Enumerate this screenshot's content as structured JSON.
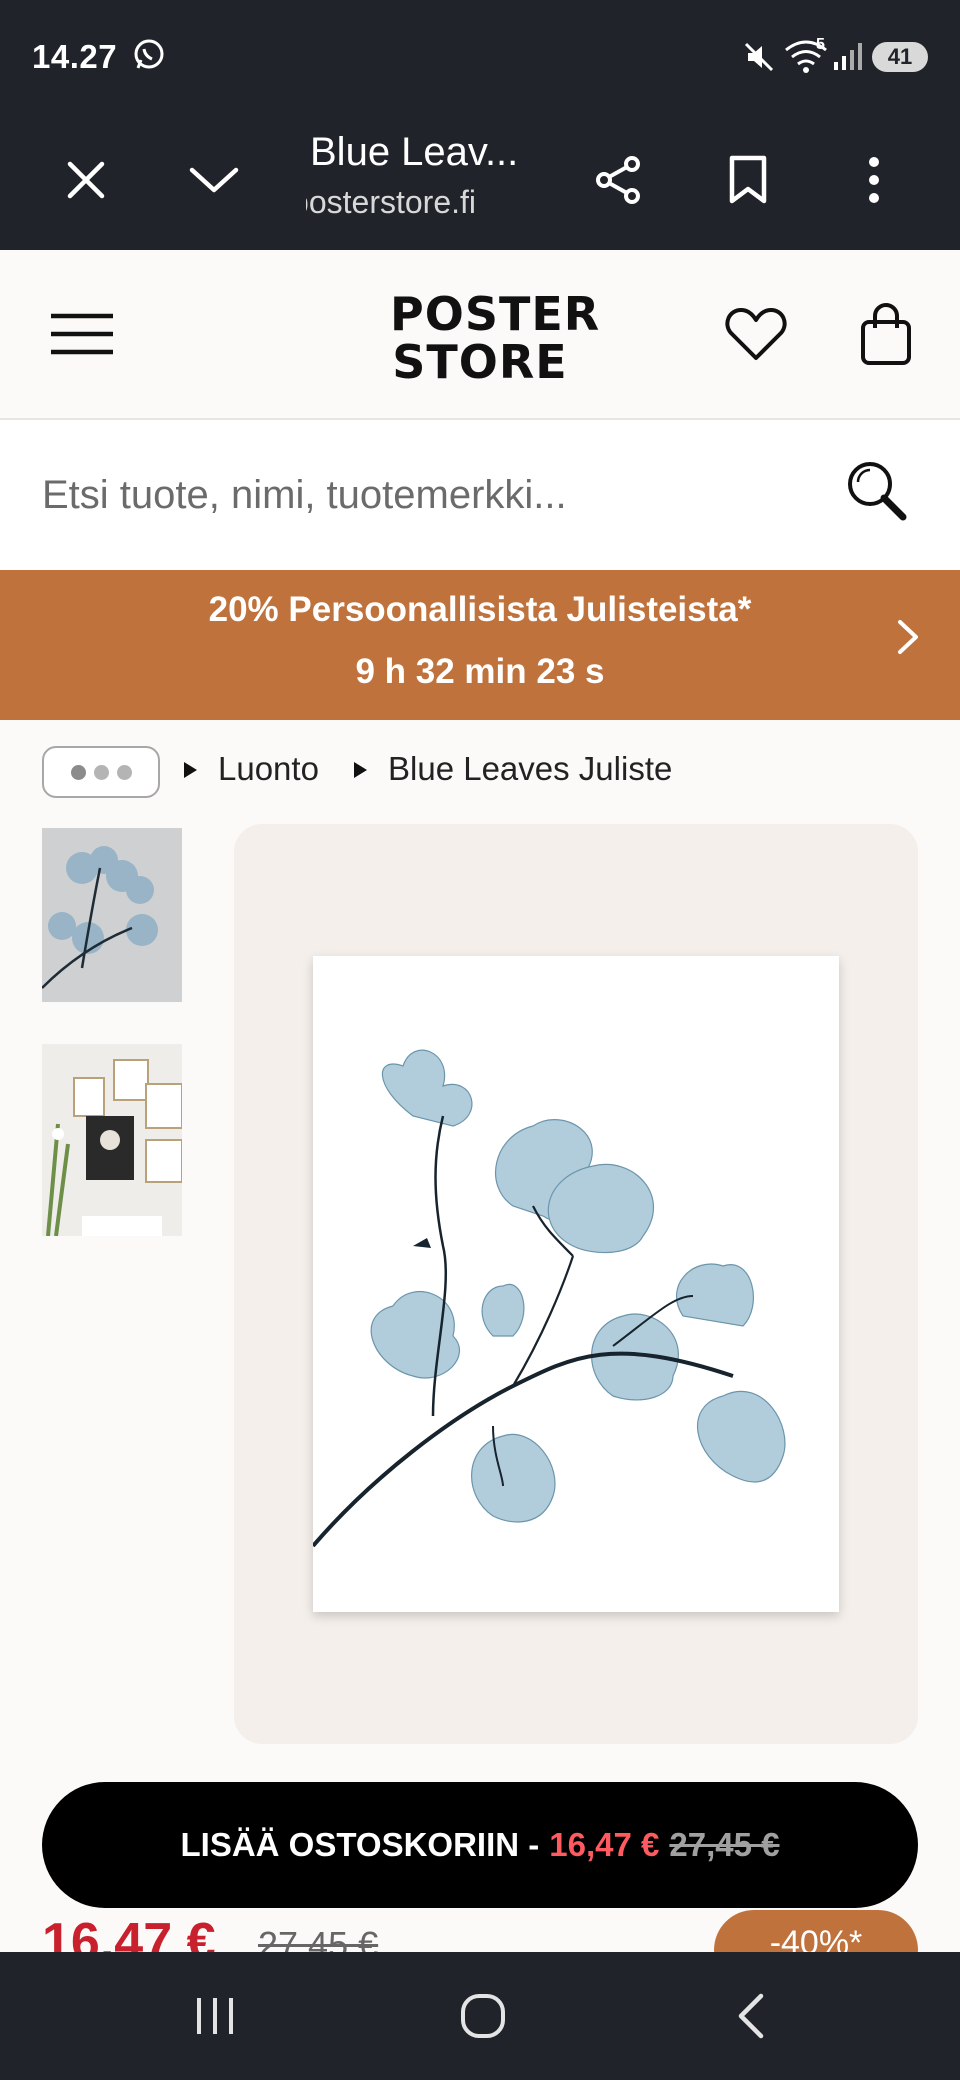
{
  "status_bar": {
    "time": "14.27",
    "battery": "41",
    "icons": [
      "whatsapp-icon",
      "mute-icon",
      "wifi-icon",
      "signal-icon",
      "battery-icon"
    ],
    "wifi_badge": "5"
  },
  "browser": {
    "page_title": "Blue Leav...",
    "domain": "posterstore.fi",
    "icons": [
      "close-icon",
      "chevron-down-icon",
      "share-icon",
      "bookmark-icon",
      "more-vert-icon"
    ]
  },
  "header": {
    "logo_line1": "POSTER",
    "logo_line2": "STORE",
    "icons": [
      "menu-icon",
      "heart-icon",
      "shopping-bag-icon"
    ]
  },
  "search": {
    "placeholder": "Etsi tuote, nimi, tuotemerkki...",
    "icon": "search-icon"
  },
  "promo": {
    "title": "20% Persoonallisista Julisteista*",
    "countdown": "9 h 32 min 23 s",
    "color": "#c0723c"
  },
  "breadcrumb": {
    "items": [
      {
        "label": "Luonto"
      },
      {
        "label": "Blue Leaves Juliste"
      }
    ]
  },
  "product": {
    "price": "16,47 €",
    "old_price": "27,45 €",
    "discount": "-40%*",
    "price_color": "#c8202d"
  },
  "cart_button": {
    "label": "LISÄÄ OSTOSKORIIN -",
    "price": "16,47 €",
    "old_price": "27,45 €"
  },
  "nav": {
    "icons": [
      "recent-apps-icon",
      "home-icon",
      "back-icon"
    ]
  }
}
